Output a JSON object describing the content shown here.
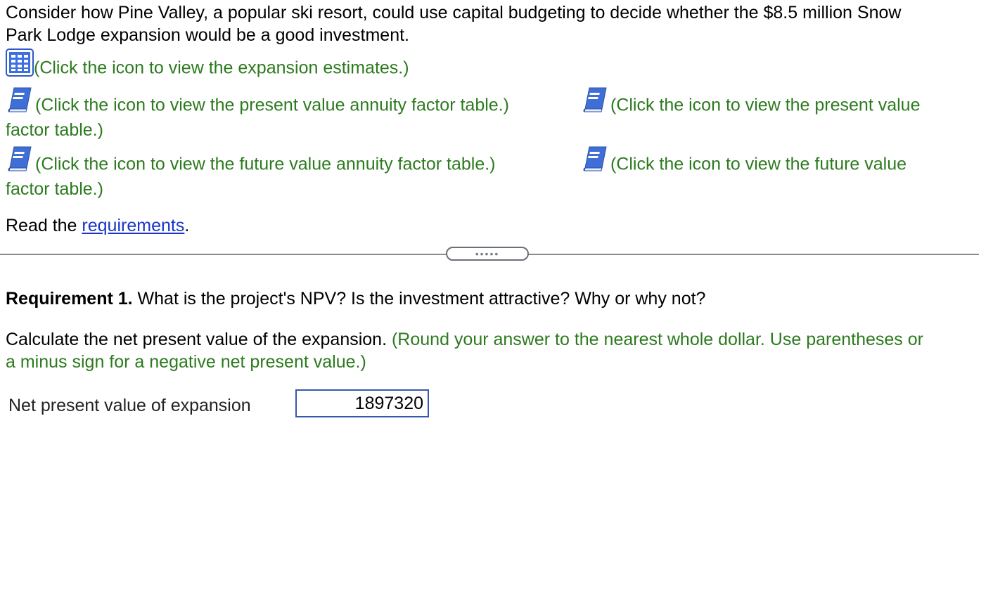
{
  "intro": {
    "line1": "Consider how Pine Valley, a popular ski resort, could use capital budgeting to decide whether the $8.5 million Snow",
    "line2": "Park Lodge expansion would be a good investment."
  },
  "links": {
    "expansion_estimates": "(Click the icon to view the expansion estimates.)",
    "pv_annuity_table": "(Click the icon to view the present value annuity factor table.)",
    "pv_table_part1": "(Click the icon to view the present value",
    "pv_table_part2": "factor table.)",
    "fv_annuity_table": "(Click the icon to view the future value annuity factor table.)",
    "fv_table_part1": "(Click the icon to view the future value",
    "fv_table_part2": "factor table.)"
  },
  "read": {
    "prefix": "Read the ",
    "link": "requirements",
    "suffix": "."
  },
  "divider": {
    "handle_label": "•••••"
  },
  "requirement": {
    "label": "Requirement 1.",
    "question": " What is the project's NPV? Is the investment attractive? Why or why not?"
  },
  "instruction": {
    "text": "Calculate the net present value of the expansion. ",
    "hint_part1": "(Round your answer to the nearest whole dollar. Use parentheses or",
    "hint_part2": "a minus sign for a negative net present value.)"
  },
  "npv": {
    "label": "Net present value of expansion",
    "value": "1897320"
  },
  "icons": {
    "grid": "spreadsheet-grid-icon",
    "book": "book-icon"
  },
  "colors": {
    "hint_green": "#2c7a1e",
    "link_blue": "#1a35c8",
    "input_border": "#3857b0"
  }
}
